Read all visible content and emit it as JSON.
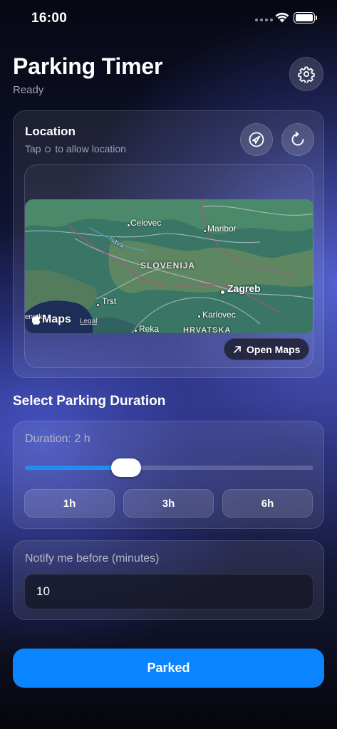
{
  "status_bar": {
    "time": "16:00"
  },
  "header": {
    "title": "Parking Timer",
    "status": "Ready",
    "settings_icon": "gear-icon"
  },
  "location": {
    "title": "Location",
    "hint_prefix": "Tap",
    "hint_suffix": "to allow location",
    "nav_icon": "location-arrow-icon",
    "refresh_icon": "refresh-icon",
    "map": {
      "labels": {
        "celovec": "Celovec",
        "maribor": "Maribor",
        "sava": "Sava",
        "slovenija": "SLOVENIJA",
        "trst": "Trst",
        "zagreb": "Zagreb",
        "karlovec": "Karlovec",
        "reka": "Reka",
        "hrvatska": "HRVATSKA",
        "benetke": "enetke"
      },
      "logo_text": "Maps",
      "legal_text": "Legal"
    },
    "open_maps_label": "Open Maps"
  },
  "duration": {
    "section_title": "Select Parking Duration",
    "label": "Duration: 2 h",
    "slider_fraction": 0.35,
    "presets": [
      "1h",
      "3h",
      "6h"
    ]
  },
  "notify": {
    "label": "Notify me before (minutes)",
    "value": "10"
  },
  "action": {
    "parked_label": "Parked"
  },
  "colors": {
    "accent": "#0a84ff",
    "slider_fill": "#1e8ef4"
  }
}
